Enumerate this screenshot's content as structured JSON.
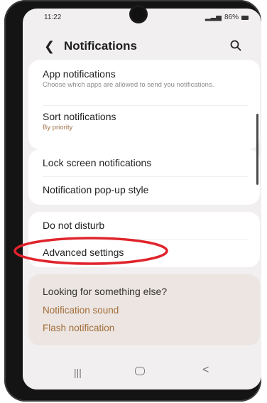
{
  "statusbar": {
    "time": "11:22",
    "battery": "86%"
  },
  "header": {
    "title": "Notifications"
  },
  "group1": {
    "app_notifications": {
      "title": "App notifications",
      "subtitle": "Choose which apps are allowed to send you notifications."
    },
    "sort_notifications": {
      "title": "Sort notifications",
      "subtitle": "By priority"
    }
  },
  "group2": {
    "lock_screen": "Lock screen notifications",
    "popup_style": "Notification pop-up style"
  },
  "group3": {
    "do_not_disturb": "Do not disturb",
    "advanced_settings": "Advanced settings"
  },
  "suggestions": {
    "title": "Looking for something else?",
    "links": [
      "Notification sound",
      "Flash notification"
    ]
  },
  "colors": {
    "accent": "#a16d3b",
    "highlight": "#e0232b"
  },
  "icons": [
    "back-arrow-icon",
    "search-icon",
    "recent-apps-icon",
    "home-icon",
    "nav-back-icon"
  ]
}
